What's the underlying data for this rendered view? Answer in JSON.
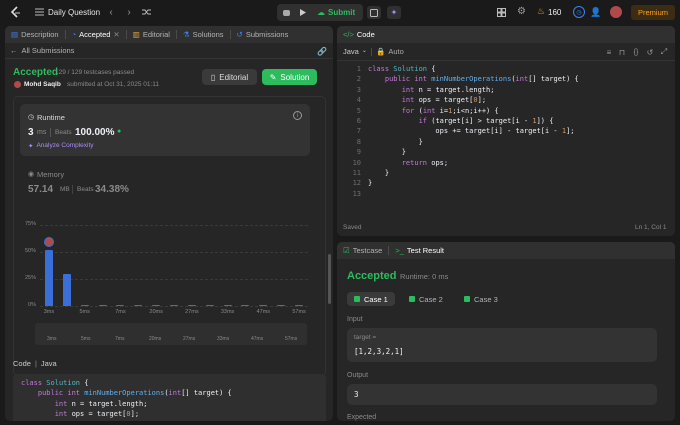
{
  "topbar": {
    "problem_list_label": "Daily Question",
    "submit_label": "Submit",
    "streak_count": "160",
    "premium_label": "Premium"
  },
  "left_tabs": [
    {
      "label": "Description"
    },
    {
      "label": "Accepted"
    },
    {
      "label": "Editorial"
    },
    {
      "label": "Solutions"
    },
    {
      "label": "Submissions"
    }
  ],
  "submission": {
    "back_label": "All Submissions",
    "status": "Accepted",
    "passed": "129 / 129 testcases passed",
    "author": "Mohd Saqib",
    "submitted_at": "submitted at Oct 31, 2025 01:11",
    "editorial_btn": "Editorial",
    "solution_btn": "Solution",
    "runtime_label": "Runtime",
    "runtime_value": "3",
    "runtime_unit": "ms",
    "beats_label": "Beats",
    "runtime_beats": "100.00%",
    "analyze_label": "Analyze Complexity",
    "memory_label": "Memory",
    "memory_value": "57.14",
    "memory_unit": "MB",
    "memory_beats": "34.38%",
    "code_label": "Code",
    "code_lang": "Java"
  },
  "chart_data": {
    "type": "bar",
    "yticks": [
      "75%",
      "50%",
      "25%",
      "0%"
    ],
    "ylim": [
      0,
      75
    ],
    "x_labels": [
      "3ms",
      "5ms",
      "7ms",
      "20ms",
      "27ms",
      "33ms",
      "47ms",
      "57ms"
    ],
    "values": [
      52,
      30,
      1,
      1,
      1,
      1,
      1,
      1,
      1,
      1,
      1,
      1,
      1,
      1,
      1
    ],
    "highlight_index": 0
  },
  "code_panel": {
    "title": "Code",
    "language": "Java",
    "mode": "Auto",
    "saved_label": "Saved",
    "cursor_pos": "Ln 1, Col 1"
  },
  "code_lines": [
    "class Solution {",
    "    public int minNumberOperations(int[] target) {",
    "        int n = target.length;",
    "        int ops = target[0];",
    "        for (int i=1;i<n;i++) {",
    "            if (target[i] > target[i - 1]) {",
    "                ops += target[i] - target[i - 1];",
    "            }",
    "        }",
    "        return ops;",
    "    }",
    "}",
    ""
  ],
  "bottom_code_lines": [
    "class Solution {",
    "    public int minNumberOperations(int[] target) {",
    "        int n = target.length;",
    "        int ops = target[0];"
  ],
  "test_panel": {
    "testcase_tab": "Testcase",
    "result_tab": "Test Result",
    "status": "Accepted",
    "runtime": "Runtime: 0 ms",
    "cases": [
      "Case 1",
      "Case 2",
      "Case 3"
    ],
    "input_label": "Input",
    "input_var": "target =",
    "input_value": "[1,2,3,2,1]",
    "output_label": "Output",
    "output_value": "3",
    "expected_label": "Expected"
  },
  "colors": {
    "accent_green": "#2cbb5d",
    "bar_blue": "#3a6fd8",
    "premium": "#ffa116"
  }
}
